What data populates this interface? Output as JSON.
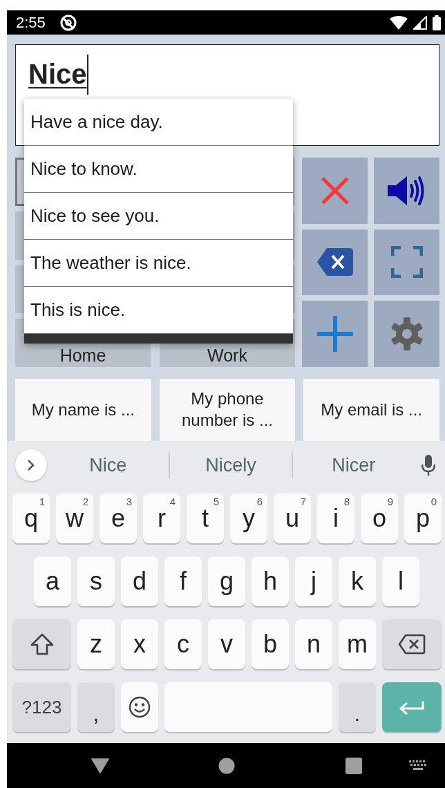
{
  "status_bar": {
    "time": "2:55"
  },
  "message_field": {
    "value": "Nice"
  },
  "phrase_popup": {
    "items": [
      "Have a nice day.",
      "Nice to know.",
      "Nice to see you.",
      "The weather is nice.",
      "This is nice."
    ]
  },
  "category_tiles": [
    {
      "label": "Home"
    },
    {
      "label": "Work"
    }
  ],
  "quick_phrases": [
    "My name is ...",
    "My phone number is ...",
    "My email is ..."
  ],
  "keyboard": {
    "suggestions": [
      "Nice",
      "Nicely",
      "Nicer"
    ],
    "rows": [
      {
        "keys": [
          {
            "kind": "letter",
            "label": "q",
            "hint": "1"
          },
          {
            "kind": "letter",
            "label": "w",
            "hint": "2"
          },
          {
            "kind": "letter",
            "label": "e",
            "hint": "3"
          },
          {
            "kind": "letter",
            "label": "r",
            "hint": "4"
          },
          {
            "kind": "letter",
            "label": "t",
            "hint": "5"
          },
          {
            "kind": "letter",
            "label": "y",
            "hint": "6"
          },
          {
            "kind": "letter",
            "label": "u",
            "hint": "7"
          },
          {
            "kind": "letter",
            "label": "i",
            "hint": "8"
          },
          {
            "kind": "letter",
            "label": "o",
            "hint": "9"
          },
          {
            "kind": "letter",
            "label": "p",
            "hint": "0"
          }
        ]
      },
      {
        "keys": [
          {
            "kind": "letter",
            "label": "a"
          },
          {
            "kind": "letter",
            "label": "s"
          },
          {
            "kind": "letter",
            "label": "d"
          },
          {
            "kind": "letter",
            "label": "f"
          },
          {
            "kind": "letter",
            "label": "g"
          },
          {
            "kind": "letter",
            "label": "h"
          },
          {
            "kind": "letter",
            "label": "j"
          },
          {
            "kind": "letter",
            "label": "k"
          },
          {
            "kind": "letter",
            "label": "l"
          }
        ]
      },
      {
        "keys": [
          {
            "kind": "shift"
          },
          {
            "kind": "letter",
            "label": "z"
          },
          {
            "kind": "letter",
            "label": "x"
          },
          {
            "kind": "letter",
            "label": "c"
          },
          {
            "kind": "letter",
            "label": "v"
          },
          {
            "kind": "letter",
            "label": "b"
          },
          {
            "kind": "letter",
            "label": "n"
          },
          {
            "kind": "letter",
            "label": "m"
          },
          {
            "kind": "backspace"
          }
        ]
      },
      {
        "keys": [
          {
            "kind": "symbols",
            "label": "?123"
          },
          {
            "kind": "punct",
            "label": ","
          },
          {
            "kind": "emoji"
          },
          {
            "kind": "space"
          },
          {
            "kind": "punct",
            "label": "."
          },
          {
            "kind": "enter"
          }
        ]
      }
    ]
  }
}
